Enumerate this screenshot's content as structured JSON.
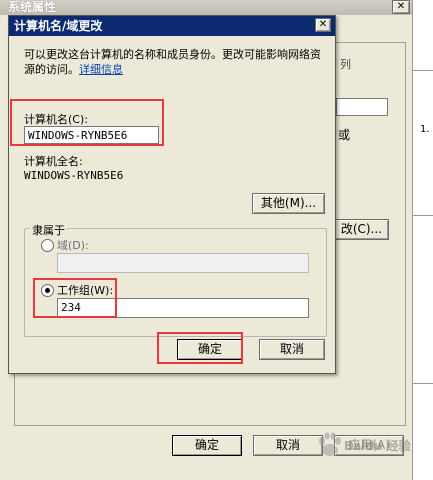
{
  "parent_window": {
    "title": "系统属性",
    "close_glyph": "✕",
    "side_text_or": "或",
    "side_number": "1.",
    "side_button_suffix": "改(C)...",
    "ok_label": "确定",
    "cancel_label": "取消",
    "apply_label": "应用(A)"
  },
  "dialog": {
    "title": "计算机名/域更改",
    "close_glyph": "✕",
    "description": "可以更改这台计算机的名称和成员身份。更改可能影响网络资源的访问。",
    "details_link": "详细信息",
    "computer_name_label": "计算机名(C):",
    "computer_name_value": "WINDOWS-RYNB5E6",
    "full_name_label": "计算机全名:",
    "full_name_value": "WINDOWS-RYNB5E6",
    "more_button": "其他(M)...",
    "member_of_label": "隶属于",
    "domain_label": "域(D):",
    "domain_value": "",
    "workgroup_label": "工作组(W):",
    "workgroup_value": "234",
    "ok_label": "确定",
    "cancel_label": "取消"
  },
  "watermark": "Baidu 经验",
  "colors": {
    "titlebar": "#0b2a6f",
    "dialog_bg": "#ece9d8",
    "highlight": "#e8383d",
    "link": "#0645ad"
  }
}
